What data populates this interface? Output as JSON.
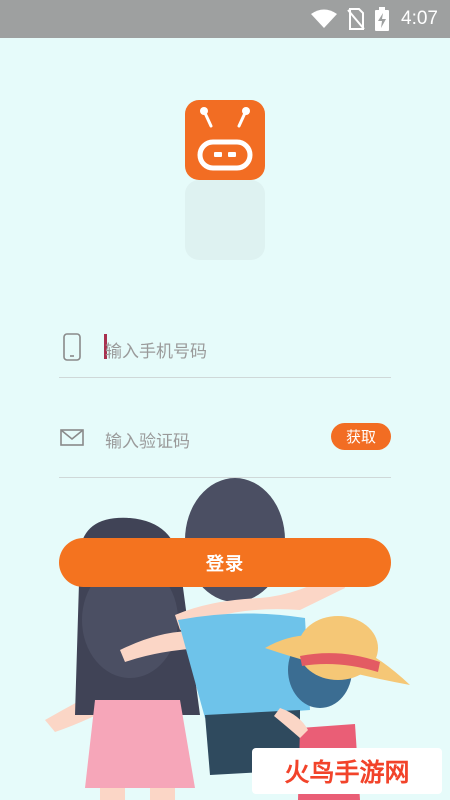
{
  "status_bar": {
    "time": "4:07",
    "icons": [
      "wifi-icon",
      "no-sim-icon",
      "battery-charging-icon"
    ]
  },
  "logo": {
    "icon": "robot-icon",
    "color": "#f26d23"
  },
  "phone_input": {
    "placeholder": "输入手机号码",
    "icon": "phone-icon"
  },
  "code_input": {
    "placeholder": "输入验证码",
    "icon": "envelope-icon",
    "get_code_label": "获取"
  },
  "login_button": {
    "label": "登录"
  },
  "watermark": {
    "text": "火鸟手游网"
  },
  "colors": {
    "background": "#e6fbfa",
    "accent": "#f4731f",
    "status_bar": "#9ea0a0"
  }
}
